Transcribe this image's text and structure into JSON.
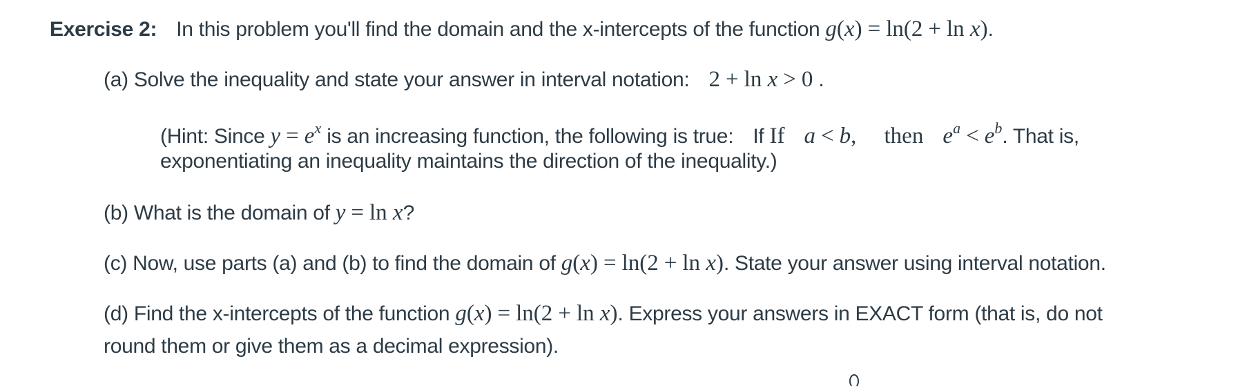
{
  "exercise": {
    "label": "Exercise 2:",
    "intro_text": "In this problem you'll find the domain and the x-intercepts of the function",
    "function_lhs": "g(x)",
    "function_rhs": "ln(2 + ln x)",
    "intro_end": "."
  },
  "part_a": {
    "label": "(a)",
    "text": "Solve the inequality and state your answer in interval notation:",
    "math": "2 + ln x > 0",
    "end": "."
  },
  "hint": {
    "prefix": "(Hint: Since",
    "math_eq": "y = e^x",
    "middle": "is an increasing function, the following is true:",
    "if_plain": "If",
    "if_math": "If",
    "cond": "a < b,",
    "then": "then",
    "result_base": "e",
    "result_a_exp": "a",
    "result_lt": "<",
    "result_b_exp": "b",
    "suffix": ". That is,",
    "line2": "exponentiating an inequality maintains the direction of the inequality.)"
  },
  "part_b": {
    "label": "(b)",
    "text": "What is the domain of",
    "math": "y = ln x",
    "end": "?"
  },
  "part_c": {
    "label": "(c)",
    "text": "Now, use parts (a) and (b) to find the domain of",
    "math_lhs": "g(x)",
    "math_rhs": "ln(2 + ln x)",
    "end": ". State your answer using interval notation."
  },
  "part_d": {
    "label": "(d)",
    "text": "Find the x-intercepts of the function",
    "math_lhs": "g(x)",
    "math_rhs": "ln(2 + ln x)",
    "end": ". Express your answers in EXACT form (that is, do not",
    "line2": "round them or give them as a decimal expression)."
  }
}
